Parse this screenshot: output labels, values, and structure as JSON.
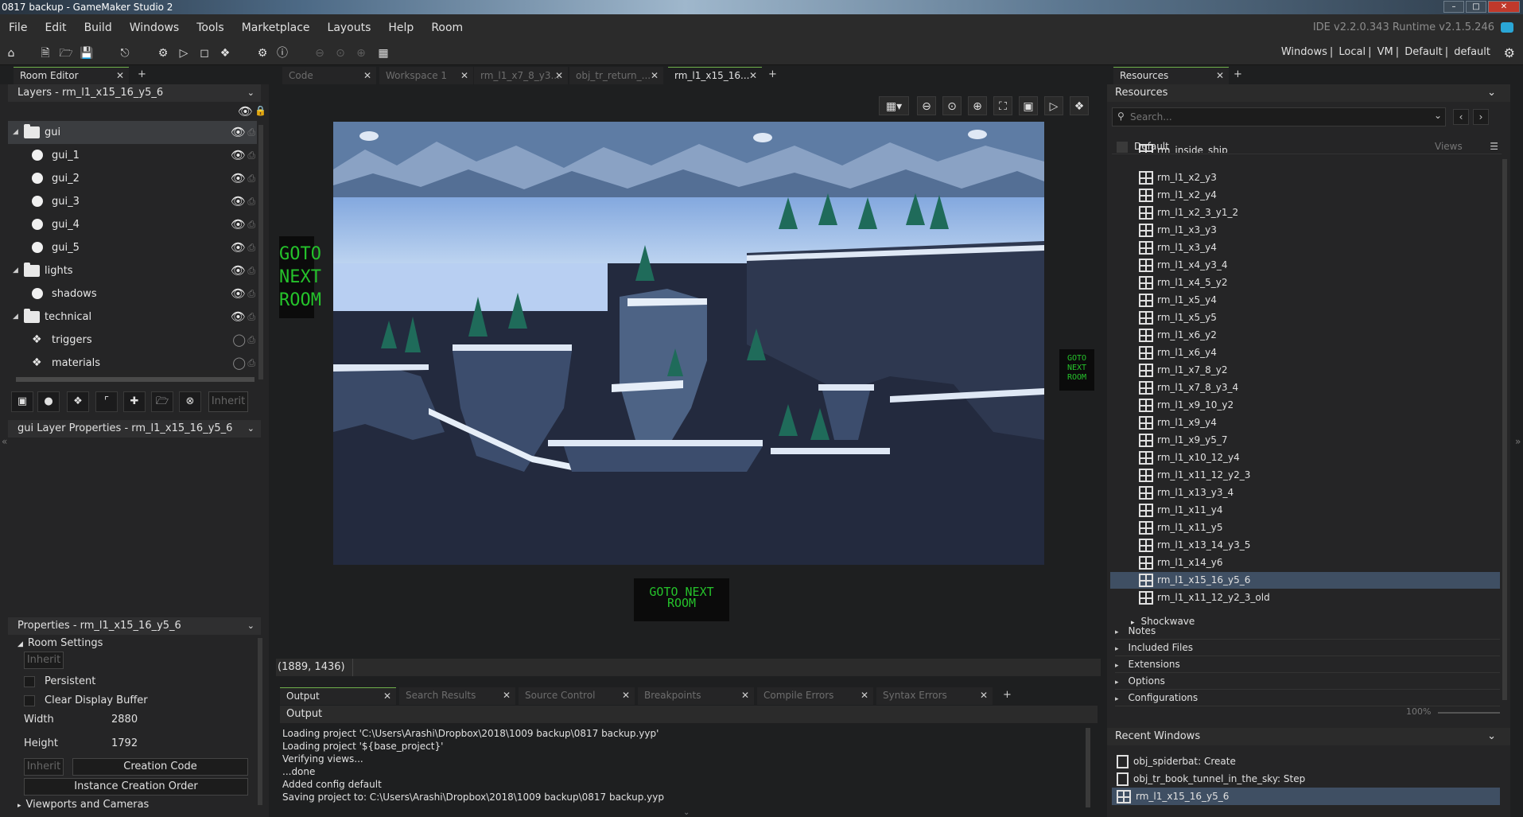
{
  "window": {
    "title": "0817 backup - GameMaker Studio 2"
  },
  "menu": {
    "items": [
      "File",
      "Edit",
      "Build",
      "Windows",
      "Tools",
      "Marketplace",
      "Layouts",
      "Help",
      "Room"
    ],
    "version": "IDE v2.2.0.343 Runtime v2.1.5.246"
  },
  "toolbar": {
    "targets": [
      "Windows",
      "Local",
      "VM",
      "Default",
      "default"
    ]
  },
  "room_editor": {
    "tab": "Room Editor",
    "layers_header": "Layers - rm_l1_x15_16_y5_6",
    "layers": [
      {
        "name": "gui",
        "type": "folder",
        "visible": true
      },
      {
        "name": "gui_1",
        "type": "instance",
        "visible": true
      },
      {
        "name": "gui_2",
        "type": "instance",
        "visible": true
      },
      {
        "name": "gui_3",
        "type": "instance",
        "visible": true
      },
      {
        "name": "gui_4",
        "type": "instance",
        "visible": true
      },
      {
        "name": "gui_5",
        "type": "instance",
        "visible": true
      },
      {
        "name": "lights",
        "type": "folder",
        "visible": true
      },
      {
        "name": "shadows",
        "type": "instance",
        "visible": true
      },
      {
        "name": "technical",
        "type": "folder",
        "visible": true
      },
      {
        "name": "triggers",
        "type": "tile",
        "visible": false
      },
      {
        "name": "materials",
        "type": "tile",
        "visible": false
      }
    ],
    "inherit_label": "Inherit",
    "layer_props_header": "gui Layer Properties - rm_l1_x15_16_y5_6",
    "properties_header": "Properties - rm_l1_x15_16_y5_6",
    "room_settings": "Room Settings",
    "persistent": "Persistent",
    "clear_display": "Clear Display Buffer",
    "width_label": "Width",
    "width_value": "2880",
    "height_label": "Height",
    "height_value": "1792",
    "creation_code": "Creation Code",
    "instance_order": "Instance Creation Order",
    "viewports": "Viewports and Cameras"
  },
  "doc_tabs": [
    {
      "label": "Code",
      "active": false
    },
    {
      "label": "Workspace 1",
      "active": false
    },
    {
      "label": "rm_l1_x7_8_y3...",
      "active": false
    },
    {
      "label": "obj_tr_return_...",
      "active": false
    },
    {
      "label": "rm_l1_x15_16...",
      "active": true
    }
  ],
  "canvas": {
    "goto_text": "GOTO NEXT ROOM",
    "coords": "(1889, 1436)"
  },
  "output": {
    "tabs": [
      "Output",
      "Search Results",
      "Source Control",
      "Breakpoints",
      "Compile Errors",
      "Syntax Errors"
    ],
    "header": "Output",
    "lines": [
      "Loading project 'C:\\Users\\Arashi\\Dropbox\\2018\\1009 backup\\0817 backup.yyp'",
      "Loading project '${base_project}'",
      "Verifying views...",
      "...done",
      "Added config default",
      "Saving project to: C:\\Users\\Arashi\\Dropbox\\2018\\1009 backup\\0817 backup.yyp"
    ]
  },
  "resources": {
    "tab": "Resources",
    "header": "Resources",
    "search_placeholder": "Search...",
    "group": "Default",
    "views": "Views",
    "rooms": [
      "rm_inside_ship",
      "rm_l1_x2_y3",
      "rm_l1_x2_y4",
      "rm_l1_x2_3_y1_2",
      "rm_l1_x3_y3",
      "rm_l1_x3_y4",
      "rm_l1_x4_y3_4",
      "rm_l1_x4_5_y2",
      "rm_l1_x5_y4",
      "rm_l1_x5_y5",
      "rm_l1_x6_y2",
      "rm_l1_x6_y4",
      "rm_l1_x7_8_y2",
      "rm_l1_x7_8_y3_4",
      "rm_l1_x9_10_y2",
      "rm_l1_x9_y4",
      "rm_l1_x9_y5_7",
      "rm_l1_x10_12_y4",
      "rm_l1_x11_12_y2_3",
      "rm_l1_x13_y3_4",
      "rm_l1_x11_y4",
      "rm_l1_x11_y5",
      "rm_l1_x13_14_y3_5",
      "rm_l1_x14_y6",
      "rm_l1_x15_16_y5_6",
      "rm_l1_x11_12_y2_3_old"
    ],
    "selected_room": "rm_l1_x15_16_y5_6",
    "shockwave": "Shockwave",
    "sections": [
      "Notes",
      "Included Files",
      "Extensions",
      "Options",
      "Configurations"
    ],
    "zoom": "100%"
  },
  "recent": {
    "header": "Recent Windows",
    "items": [
      {
        "label": "obj_spiderbat: Create",
        "kind": "object"
      },
      {
        "label": "obj_tr_book_tunnel_in_the_sky: Step",
        "kind": "object"
      },
      {
        "label": "rm_l1_x15_16_y5_6",
        "kind": "room",
        "selected": true
      }
    ]
  },
  "colors": {
    "accent_green": "#6fb04a",
    "selection_blue": "#3f4f63",
    "goto_green": "#25c22b"
  }
}
